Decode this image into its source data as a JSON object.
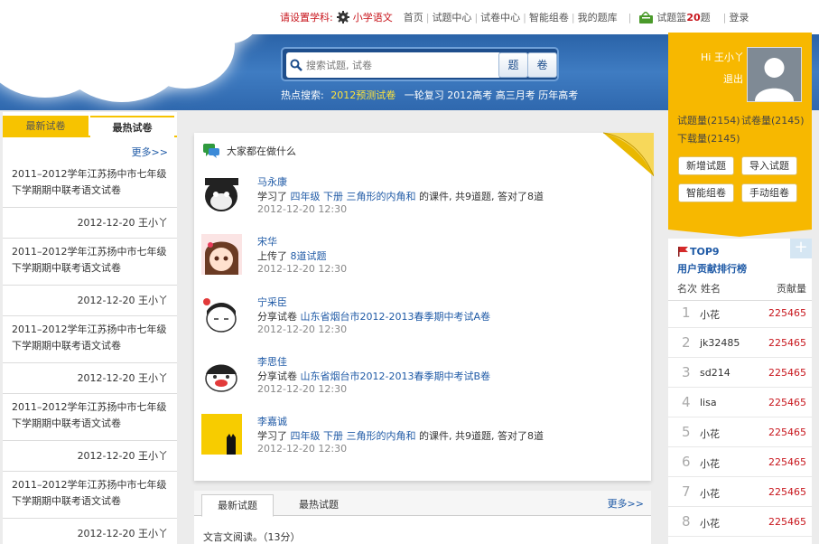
{
  "topbar": {
    "subject_label": "请设置学科:",
    "subject": "小学语文",
    "nav": [
      "首页",
      "试题中心",
      "试卷中心",
      "智能组卷",
      "我的题库"
    ],
    "basket_label": "试题篮",
    "basket_count": "20",
    "basket_unit": "题",
    "login": "登录"
  },
  "search": {
    "placeholder": "搜索试题, 试卷",
    "btn_question": "题",
    "btn_paper": "卷",
    "hot_label": "热点搜索:",
    "hot_terms": [
      "2012预测试卷",
      "一轮复习",
      "2012高考",
      "高三月考",
      "历年高考"
    ]
  },
  "left": {
    "tabs": [
      "最新试卷",
      "最热试卷"
    ],
    "more": "更多>>",
    "items": [
      {
        "title": "2011–2012学年江苏扬中市七年级下学期期中联考语文试卷",
        "date": "2012-12-20",
        "author": "王小丫"
      },
      {
        "title": "2011–2012学年江苏扬中市七年级下学期期中联考语文试卷",
        "date": "2012-12-20",
        "author": "王小丫"
      },
      {
        "title": "2011–2012学年江苏扬中市七年级下学期期中联考语文试卷",
        "date": "2012-12-20",
        "author": "王小丫"
      },
      {
        "title": "2011–2012学年江苏扬中市七年级下学期期中联考语文试卷",
        "date": "2012-12-20",
        "author": "王小丫"
      },
      {
        "title": "2011–2012学年江苏扬中市七年级下学期期中联考语文试卷",
        "date": "2012-12-20",
        "author": "王小丫"
      }
    ]
  },
  "activity": {
    "heading": "大家都在做什么",
    "feed": [
      {
        "name": "马永康",
        "action": "学习了",
        "link": "四年级 下册 三角形的内角和",
        "suffix": "的课件, 共9道题, 答对了8道",
        "time": "2012-12-20 12:30"
      },
      {
        "name": "宋华",
        "action": "上传了",
        "link": "8道试题",
        "suffix": "",
        "time": "2012-12-20 12:30"
      },
      {
        "name": "宁采臣",
        "action": "分享试卷",
        "link": "山东省烟台市2012-2013春季期中考试A卷",
        "suffix": "",
        "time": "2012-12-20 12:30"
      },
      {
        "name": "李思佳",
        "action": "分享试卷",
        "link": "山东省烟台市2012-2013春季期中考试B卷",
        "suffix": "",
        "time": "2012-12-20 12:30"
      },
      {
        "name": "李嘉诚",
        "action": "学习了",
        "link": "四年级 下册 三角形的内角和",
        "suffix": "的课件, 共9道题, 答对了8道",
        "time": "2012-12-20 12:30"
      }
    ]
  },
  "bottom": {
    "tabs": [
      "最新试题",
      "最热试题"
    ],
    "more": "更多>>",
    "first_item": "文言文阅读。（13分）"
  },
  "user": {
    "greeting": "Hi 王小丫",
    "logout": "退出",
    "question_count": "试题量(2154)",
    "paper_count": "试卷量(2145)",
    "download_count": "下载量(2145)",
    "buttons": [
      "新增试题",
      "导入试题",
      "智能组卷",
      "手动组卷"
    ]
  },
  "ranking": {
    "badge": "TOP9",
    "title": "用户贡献排行榜",
    "headers": [
      "名次",
      "姓名",
      "贡献量"
    ],
    "rows": [
      {
        "rank": "1",
        "user": "小花",
        "score": "225465"
      },
      {
        "rank": "2",
        "user": "jk32485",
        "score": "225465"
      },
      {
        "rank": "3",
        "user": "sd214",
        "score": "225465"
      },
      {
        "rank": "4",
        "user": "lisa",
        "score": "225465"
      },
      {
        "rank": "5",
        "user": "小花",
        "score": "225465"
      },
      {
        "rank": "6",
        "user": "小花",
        "score": "225465"
      },
      {
        "rank": "7",
        "user": "小花",
        "score": "225465"
      },
      {
        "rank": "8",
        "user": "小花",
        "score": "225465"
      }
    ]
  },
  "colors": {
    "accent_yellow": "#f7b800",
    "link_blue": "#1f5aa6",
    "red": "#c8161d",
    "banner_blue": "#2f68ae"
  }
}
